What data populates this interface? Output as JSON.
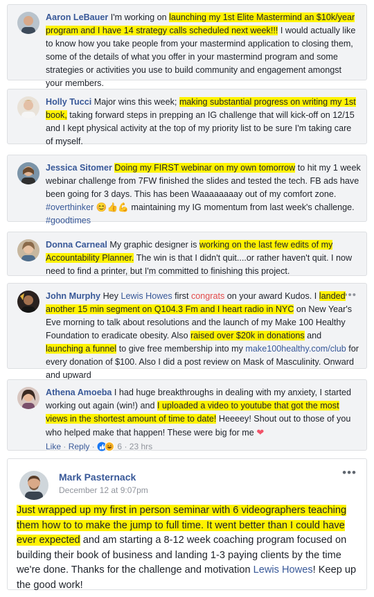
{
  "posts": [
    {
      "name": "Aaron LeBauer",
      "segments": [
        "I'm working on ",
        "launching my 1st Elite Mastermind an $10k/year program and I have 14 strategy calls scheduled next week!!!",
        " I would actually like to know how you take people from your mastermind application to closing them, some of the details of what you offer in your mastermind program and some strategies or activities you use to build community and engagement amongst your members."
      ]
    },
    {
      "name": "Holly Tucci",
      "segments": [
        "Major wins this week; ",
        "making substantial progress on writing my 1st book,",
        " taking forward steps in prepping an IG challenge that will kick-off on 12/15 and I kept physical activity at the top of my priority list to be sure I'm taking care of myself."
      ]
    },
    {
      "name": "Jessica Sitomer",
      "segments": [
        "Doing my FIRST webinar on my own tomorrow",
        " to hit my 1 week webinar challenge from 7FW finished the slides and tested the tech. FB ads have been going for 3 days. This has been Waaaaaaaay out of my comfort zone. ",
        "#overthinker",
        " 😊👍💪",
        " maintaining my IG momentum from last week's challenge. ",
        "#goodtimes"
      ]
    },
    {
      "name": "Donna Carneal",
      "segments": [
        "My graphic designer is ",
        "working on the last few edits of my Accountability Planner.",
        " The win is that I didn't quit....or rather haven't quit. I now need to find a printer, but I'm committed to finishing this project."
      ]
    },
    {
      "name": "John Murphy",
      "segments": [
        "Hey ",
        "Lewis Howes",
        " first ",
        "congrats",
        " on your award Kudos. I ",
        "landed another 15 min segment on Q104.3 Fm and I heart radio in NYC",
        " on New Year's Eve morning to talk about resolutions and the launch of my Make 100 Healthy Foundation to eradicate obesity. Also ",
        "raised over $20k in donations",
        " and ",
        "launching a funnel",
        " to give free membership into my ",
        "make100healthy.com/club",
        " for every donation of $100. Also I did a post review on Mask of Masculinity. Onward and upward"
      ]
    },
    {
      "name": "Athena Amoeba",
      "segments": [
        "I had huge breakthroughs in dealing with my anxiety, I started working out again (win!) and ",
        "I uploaded a video to youtube that got the most views in the shortest amount of time to date!",
        " Heeeey! Shout out to those of you who helped make that happen! These were big for me ",
        "❤"
      ],
      "actions": {
        "like": "Like",
        "dot1": "·",
        "reply": "Reply",
        "dot2": "·",
        "count": "6",
        "dot3": "·",
        "time": "23 hrs"
      }
    }
  ],
  "feature_post": {
    "name": "Mark Pasternack",
    "date": "December 12 at 9:07pm",
    "menu": "•••",
    "segments": [
      "Just wrapped up my first in person seminar with 6 videographers teaching them how to to make the jump to full time. It went better than I could have ever expected",
      " and am starting a 8-12 week coaching program focused on building their book of business and landing 1-3 paying clients by the time we're done. Thanks for the challenge and motivation ",
      "Lewis Howes",
      "! Keep up the good work!"
    ]
  },
  "colors": {
    "highlight": "#fff200",
    "link": "#385898",
    "card_bg": "#f2f3f5",
    "congrats": "#e24a4a",
    "heart": "#f25268"
  },
  "icons": [
    "like-reaction-icon",
    "haha-reaction-icon",
    "heart-emoji-icon",
    "more-options-icon"
  ]
}
